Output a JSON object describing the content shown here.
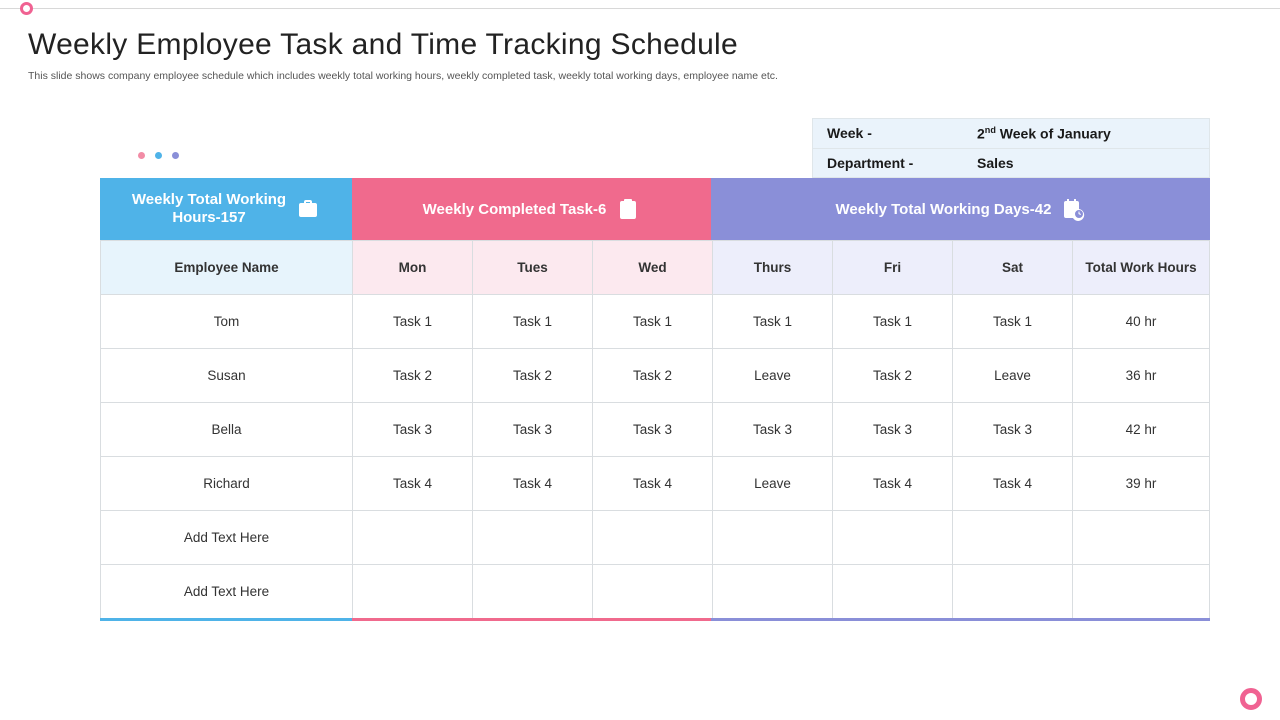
{
  "title": "Weekly Employee Task and Time Tracking Schedule",
  "subtitle": "This slide shows company employee schedule which includes weekly total working hours, weekly completed task, weekly total working days, employee name etc.",
  "info": {
    "week_label": "Week -",
    "week_value_pre": "2",
    "week_value_sup": "nd",
    "week_value_post": " Week of January",
    "dept_label": "Department -",
    "dept_value": "Sales"
  },
  "panels": {
    "hours_line1": "Weekly Total Working",
    "hours_line2": "Hours-157",
    "completed": "Weekly Completed Task-6",
    "days": "Weekly Total Working Days-42"
  },
  "headers": {
    "emp": "Employee Name",
    "mon": "Mon",
    "tue": "Tues",
    "wed": "Wed",
    "thu": "Thurs",
    "fri": "Fri",
    "sat": "Sat",
    "tot": "Total Work Hours"
  },
  "rows": [
    {
      "name": "Tom",
      "mon": "Task 1",
      "tue": "Task 1",
      "wed": "Task 1",
      "thu": "Task 1",
      "fri": "Task 1",
      "sat": "Task 1",
      "tot": "40 hr"
    },
    {
      "name": "Susan",
      "mon": "Task 2",
      "tue": "Task 2",
      "wed": "Task 2",
      "thu": "Leave",
      "fri": "Task 2",
      "sat": "Leave",
      "tot": "36 hr"
    },
    {
      "name": "Bella",
      "mon": "Task 3",
      "tue": "Task 3",
      "wed": "Task 3",
      "thu": "Task 3",
      "fri": "Task 3",
      "sat": "Task 3",
      "tot": "42 hr"
    },
    {
      "name": "Richard",
      "mon": "Task 4",
      "tue": "Task 4",
      "wed": "Task 4",
      "thu": "Leave",
      "fri": "Task 4",
      "sat": "Task 4",
      "tot": "39 hr"
    },
    {
      "name": "Add Text Here",
      "mon": "",
      "tue": "",
      "wed": "",
      "thu": "",
      "fri": "",
      "sat": "",
      "tot": ""
    },
    {
      "name": "Add Text Here",
      "mon": "",
      "tue": "",
      "wed": "",
      "thu": "",
      "fri": "",
      "sat": "",
      "tot": ""
    }
  ]
}
